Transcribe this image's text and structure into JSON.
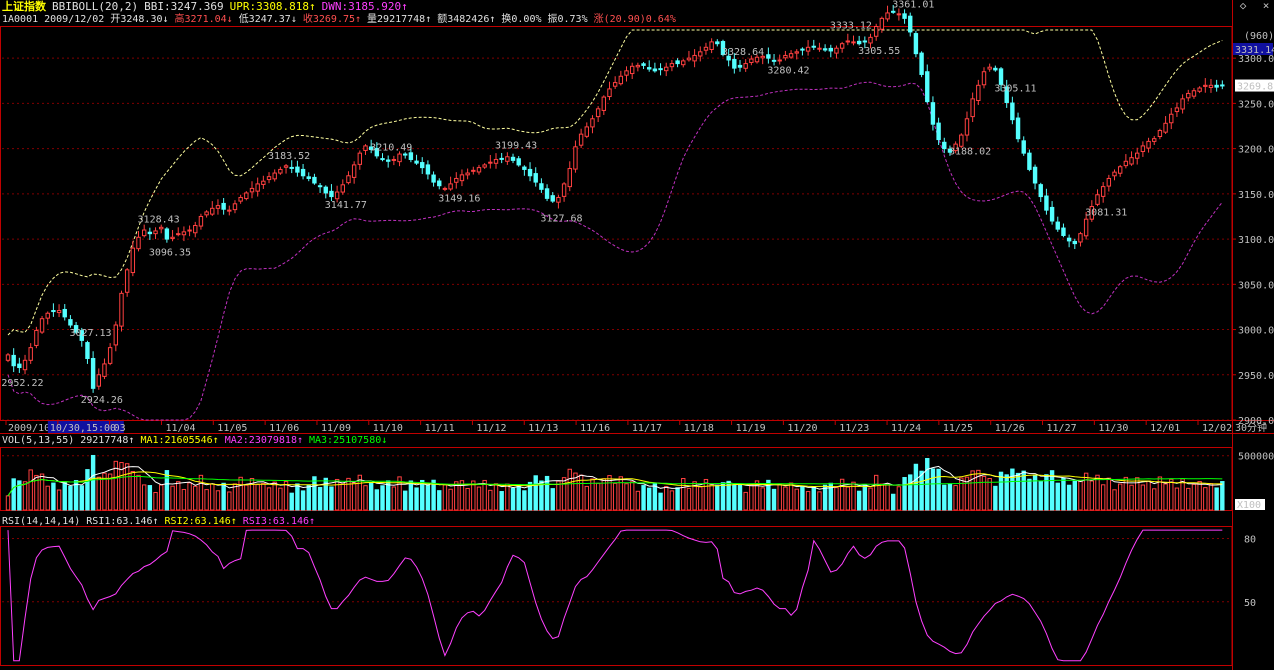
{
  "header": {
    "index_name": "上证指数",
    "indicator_name": "BBIBOLL(20,2)",
    "bbi": "BBI:3247.369",
    "upr": "UPR:3308.818↑",
    "dwn": "DWN:3185.920↑",
    "code": "1A0001",
    "date": "2009/12/02",
    "open": "开3248.30↓",
    "high": "高3271.04↓",
    "low": "低3247.37↓",
    "close": "收3269.75↑",
    "volume": "量29217748↑",
    "amount": "额3482426↑",
    "turnover": "换0.00%",
    "amplitude": "振0.73%",
    "change": "涨(20.90)0.64%"
  },
  "window_controls": {
    "close_icon": "×",
    "restore_icon": "◇"
  },
  "price_axis": {
    "labels": [
      "3300.00",
      "3250.00",
      "3200.00",
      "3150.00",
      "3100.00",
      "3050.00",
      "3000.00",
      "2950.00",
      "2900.00"
    ],
    "top_badge": "(960)",
    "top_value": "3331.14",
    "current": "3269.8"
  },
  "price_annotations": [
    {
      "text": "3027.13",
      "x": 14,
      "kind": "high"
    },
    {
      "text": "2952.22",
      "x": 2,
      "kind": "low"
    },
    {
      "text": "2924.26",
      "x": 16,
      "kind": "low"
    },
    {
      "text": "3128.43",
      "x": 26,
      "kind": "high"
    },
    {
      "text": "3096.35",
      "x": 28,
      "kind": "low"
    },
    {
      "text": "3183.52",
      "x": 48,
      "kind": "high"
    },
    {
      "text": "3141.77",
      "x": 58,
      "kind": "low"
    },
    {
      "text": "3210.49",
      "x": 66,
      "kind": "high"
    },
    {
      "text": "3149.16",
      "x": 78,
      "kind": "low"
    },
    {
      "text": "3199.43",
      "x": 88,
      "kind": "high"
    },
    {
      "text": "3127.68",
      "x": 96,
      "kind": "low"
    },
    {
      "text": "3328.64",
      "x": 127,
      "kind": "high"
    },
    {
      "text": "3280.42",
      "x": 135,
      "kind": "low"
    },
    {
      "text": "3333.12",
      "x": 146,
      "kind": "high"
    },
    {
      "text": "3305.55",
      "x": 151,
      "kind": "low"
    },
    {
      "text": "3361.01",
      "x": 157,
      "kind": "high"
    },
    {
      "text": "3188.02",
      "x": 167,
      "kind": "low"
    },
    {
      "text": "3305.11",
      "x": 175,
      "kind": "high"
    },
    {
      "text": "3081.31",
      "x": 190,
      "kind": "low"
    }
  ],
  "x_axis": {
    "dates": [
      "2009/10/29",
      "10/30,15:00",
      "03",
      "11/04",
      "11/05",
      "11/06",
      "11/09",
      "11/10",
      "11/11",
      "11/12",
      "11/13",
      "11/16",
      "11/17",
      "11/18",
      "11/19",
      "11/20",
      "11/23",
      "11/24",
      "11/25",
      "11/26",
      "11/27",
      "11/30",
      "12/01",
      "12/02"
    ],
    "highlight_index": 1,
    "period_label": "30分钟"
  },
  "volume": {
    "header": {
      "name": "VOL(5,13,55)",
      "value": "29217748↑",
      "ma1": "MA1:21605546↑",
      "ma2": "MA2:23079818↑",
      "ma3": "MA3:25107580↓"
    },
    "axis_labels": [
      "500000",
      "X100"
    ]
  },
  "rsi": {
    "header": {
      "name": "RSI(14,14,14)",
      "rsi1": "RSI1:63.146↑",
      "rsi2": "RSI2:63.146↑",
      "rsi3": "RSI3:63.146↑"
    },
    "axis_labels": [
      "80",
      "50"
    ]
  },
  "colors": {
    "up": "#ff4040",
    "down": "#55ffff",
    "upper_band": "#ffffa0",
    "lower_band": "#c030c0",
    "grid": "#800000",
    "axis": "#c00000",
    "rsi_line": "#ff40ff",
    "ma1": "#ffffff",
    "ma2": "#ffff00",
    "ma3": "#00ff00"
  },
  "chart_data": {
    "type": "candlestick",
    "x_unit": "30-minute bars, 2009/10/29 to 2009/12/02",
    "ylim": [
      2900,
      3331.14
    ],
    "close": [
      2972,
      2960,
      2958,
      2966,
      2980,
      2999,
      3012,
      3018,
      3020,
      3021,
      3014,
      3005,
      2997,
      2988,
      2968,
      2935,
      2950,
      2962,
      2980,
      3005,
      3040,
      3066,
      3090,
      3102,
      3110,
      3106,
      3109,
      3113,
      3100,
      3102,
      3106,
      3108,
      3110,
      3115,
      3125,
      3130,
      3134,
      3137,
      3133,
      3132,
      3139,
      3146,
      3151,
      3156,
      3161,
      3164,
      3169,
      3173,
      3177,
      3181,
      3179,
      3174,
      3170,
      3167,
      3162,
      3158,
      3151,
      3147,
      3152,
      3160,
      3170,
      3182,
      3195,
      3203,
      3199,
      3192,
      3188,
      3186,
      3188,
      3194,
      3193,
      3188,
      3184,
      3179,
      3172,
      3163,
      3159,
      3156,
      3161,
      3167,
      3171,
      3173,
      3176,
      3179,
      3182,
      3185,
      3188,
      3189,
      3191,
      3187,
      3182,
      3177,
      3170,
      3163,
      3155,
      3145,
      3142,
      3146,
      3161,
      3178,
      3202,
      3216,
      3224,
      3233,
      3244,
      3257,
      3266,
      3273,
      3280,
      3286,
      3291,
      3292,
      3292,
      3288,
      3286,
      3288,
      3290,
      3294,
      3294,
      3297,
      3300,
      3303,
      3307,
      3312,
      3318,
      3316,
      3304,
      3298,
      3289,
      3290,
      3294,
      3299,
      3301,
      3302,
      3300,
      3297,
      3298,
      3303,
      3305,
      3307,
      3309,
      3312,
      3313,
      3311,
      3309,
      3308,
      3311,
      3316,
      3319,
      3318,
      3316,
      3318,
      3323,
      3335,
      3344,
      3350,
      3351,
      3349,
      3344,
      3329,
      3305,
      3282,
      3252,
      3227,
      3210,
      3200,
      3196,
      3205,
      3215,
      3233,
      3255,
      3270,
      3285,
      3290,
      3287,
      3271,
      3251,
      3232,
      3211,
      3195,
      3177,
      3162,
      3147,
      3132,
      3120,
      3111,
      3104,
      3098,
      3095,
      3106,
      3122,
      3136,
      3149,
      3158,
      3167,
      3174,
      3180,
      3186,
      3190,
      3195,
      3203,
      3208,
      3211,
      3220,
      3228,
      3238,
      3245,
      3255,
      3261,
      3264,
      3267,
      3270,
      3270,
      3268,
      3269.75
    ]
  }
}
